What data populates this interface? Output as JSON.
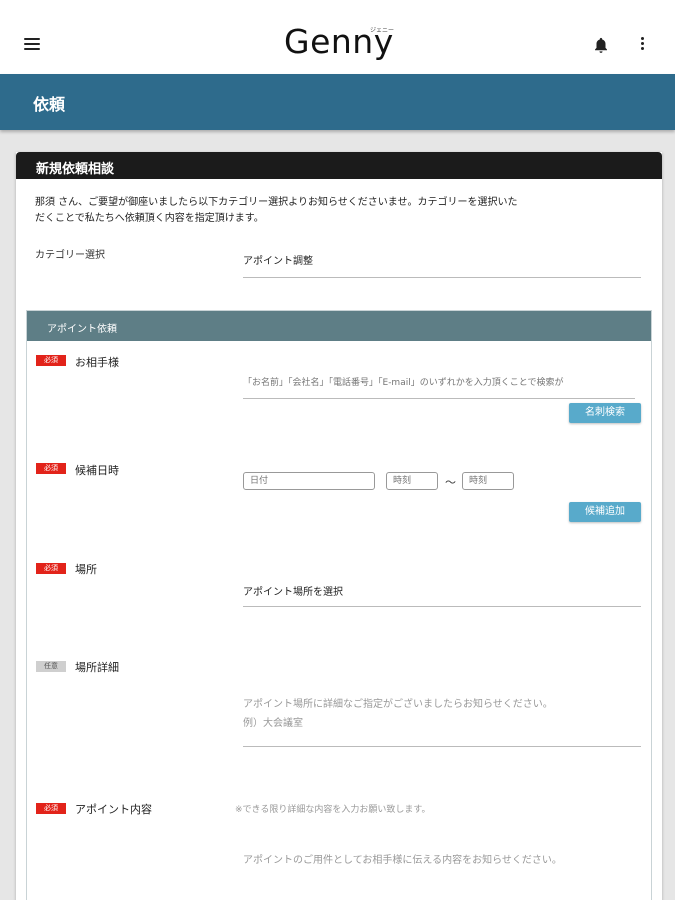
{
  "header": {
    "logo": "Genny",
    "logo_ruby": "ジェニー"
  },
  "page": {
    "title": "依頼"
  },
  "card": {
    "title": "新規依頼相談",
    "intro_line1": "那須 さん、ご要望が御座いましたら以下カテゴリー選択よりお知らせくださいませ。カテゴリーを選択いた",
    "intro_line2": "だくことで私たちへ依頼頂く内容を指定頂けます。",
    "category_label": "カテゴリー選択",
    "category_value": "アポイント調整"
  },
  "section": {
    "title": "アポイント依頼",
    "required_badge": "必須",
    "optional_badge": "任意",
    "partner": {
      "label": "お相手様",
      "placeholder": "「お名前」「会社名」「電話番号」「E-mail」のいずれかを入力頂くことで検索が",
      "button": "名刺検索"
    },
    "datetime": {
      "label": "候補日時",
      "date_placeholder": "日付",
      "time_from_placeholder": "時刻",
      "separator": "〜",
      "time_to_placeholder": "時刻",
      "button": "候補追加"
    },
    "place": {
      "label": "場所",
      "value": "アポイント場所を選択"
    },
    "place_detail": {
      "label": "場所詳細",
      "placeholder_line1": "アポイント場所に詳細なご指定がございましたらお知らせください。",
      "placeholder_line2": "例）大会議室"
    },
    "content": {
      "label": "アポイント内容",
      "note": "※できる限り詳細な内容を入力お願い致します。",
      "placeholder": "アポイントのご用件としてお相手様に伝える内容をお知らせください。"
    }
  },
  "colors": {
    "header_blue": "#2e6b8c",
    "section_head": "#5e7e86",
    "button_blue": "#58aacb",
    "required_red": "#e2231a"
  }
}
